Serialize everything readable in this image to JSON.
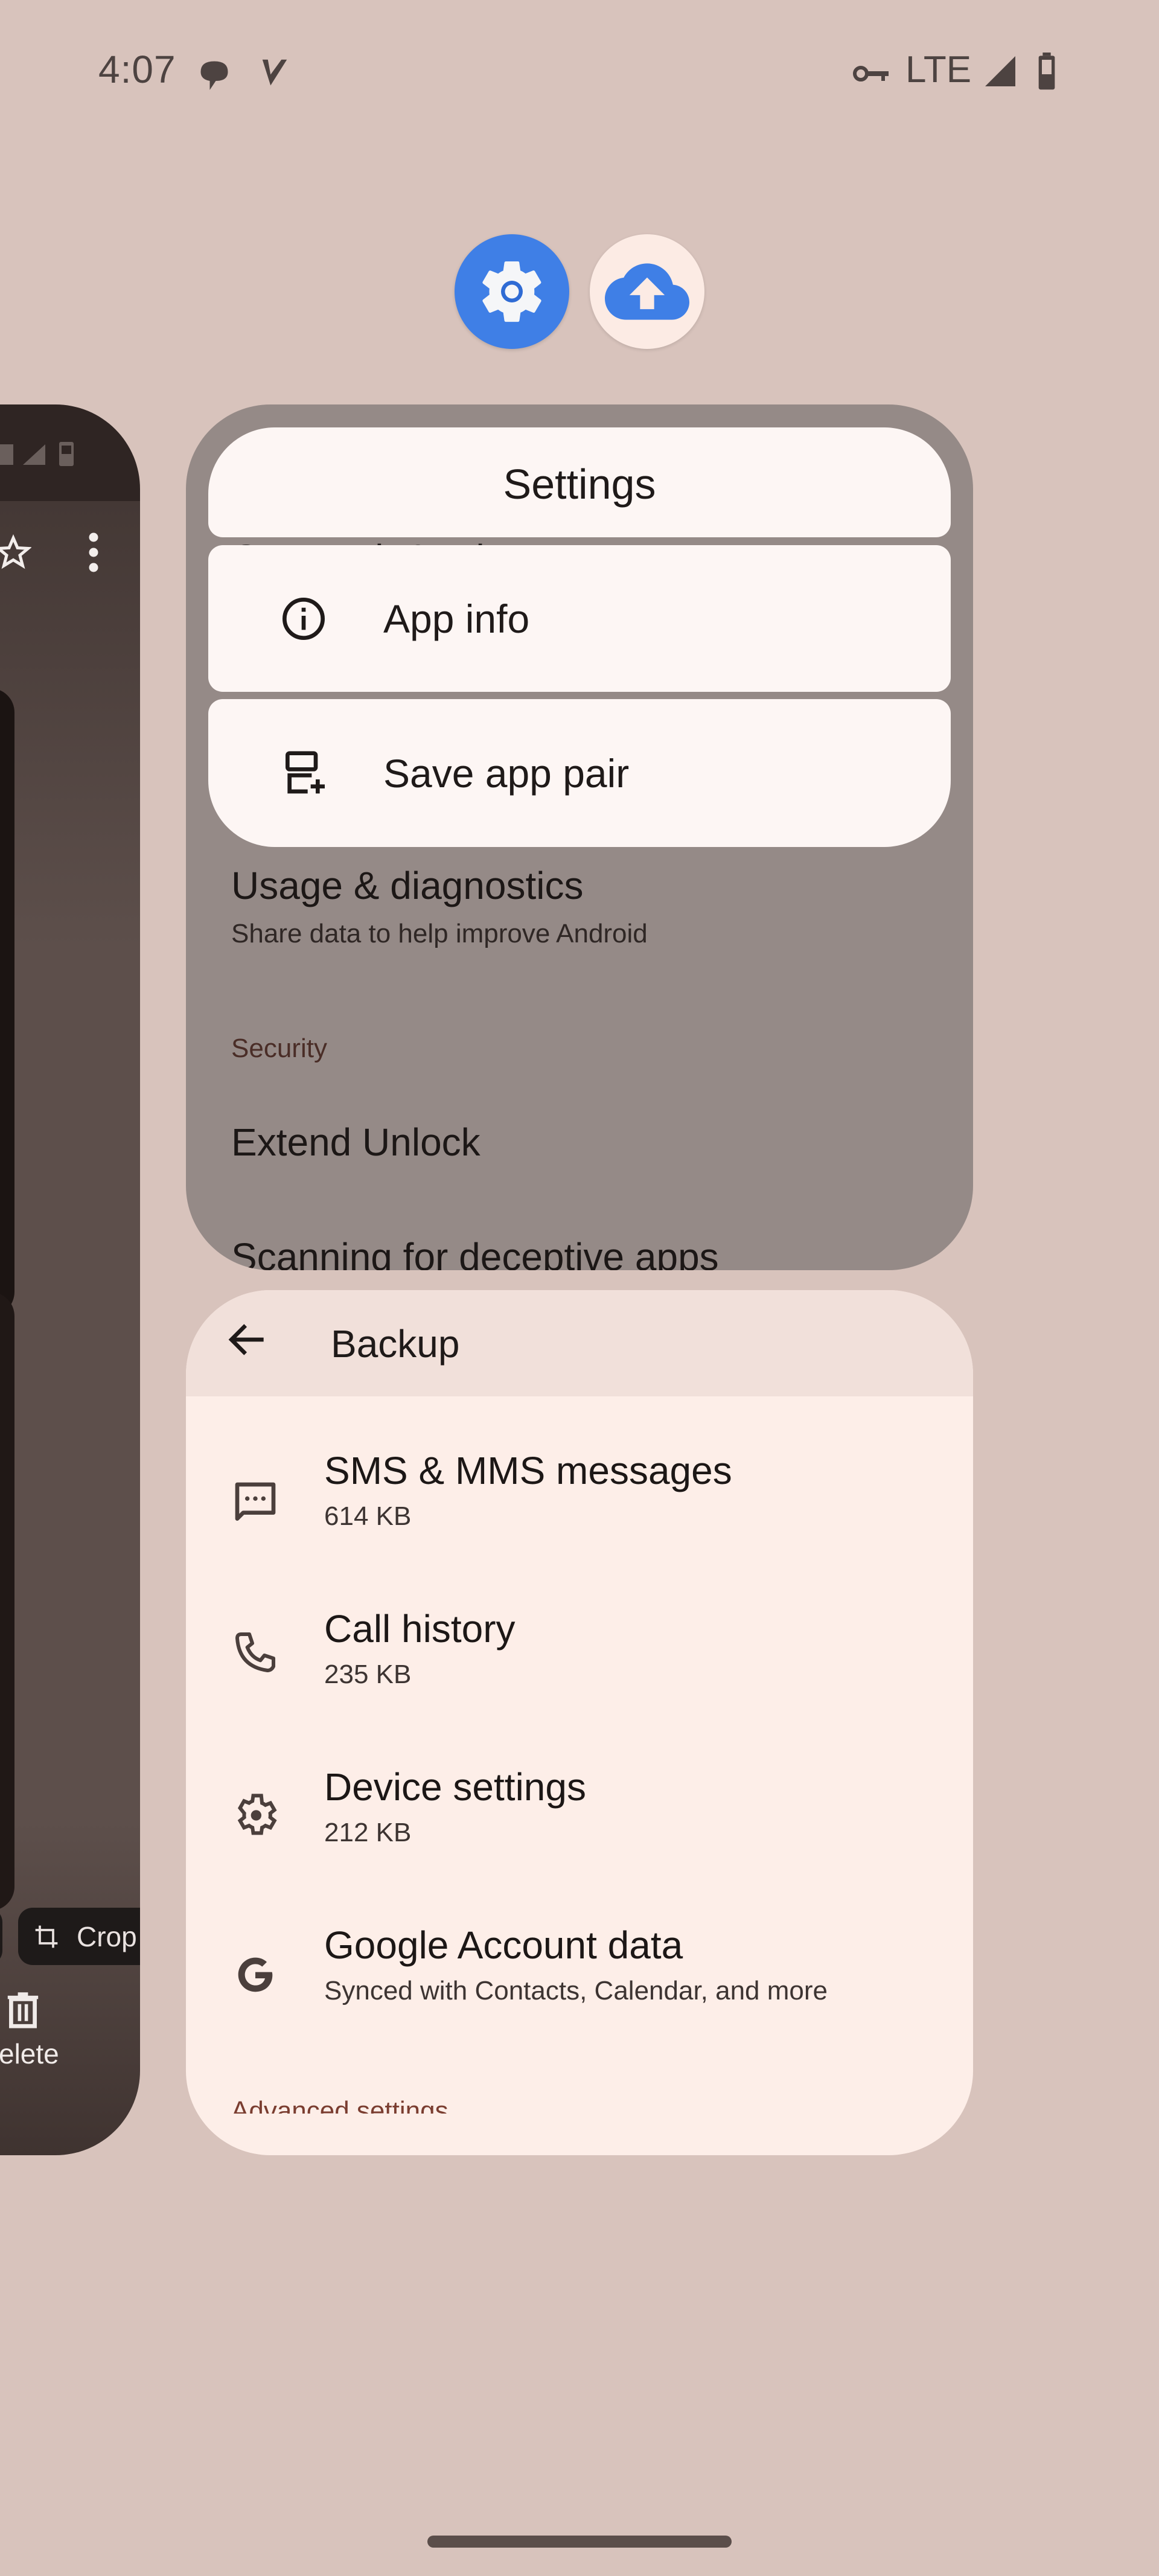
{
  "status_bar": {
    "time": "4:07",
    "network": "LTE",
    "icons": [
      "message-icon",
      "v-app-icon",
      "vpn-key-icon",
      "signal-icon",
      "battery-icon"
    ]
  },
  "app_icons": [
    {
      "name": "Settings",
      "icon": "gear-icon",
      "color": "#3f7fe6"
    },
    {
      "name": "Backup",
      "icon": "cloud-upload-icon",
      "color": "#3f7fe6"
    }
  ],
  "left_card": {
    "crop_label": "Crop",
    "delete_label": "elete"
  },
  "settings_card": {
    "menu": {
      "title": "Settings",
      "items": [
        {
          "label": "App info",
          "icon": "info-icon"
        },
        {
          "label": "Save app pair",
          "icon": "app-pair-icon"
        }
      ]
    },
    "behind_text": "Cus    Ma           it   & pri",
    "rows": [
      {
        "title": "Usage & diagnostics",
        "subtitle": "Share data to help improve Android"
      }
    ],
    "section_header": "Security",
    "security_rows": [
      "Extend Unlock",
      "Scanning for deceptive apps"
    ],
    "background": "#958a87"
  },
  "backup_card": {
    "title": "Backup",
    "items": [
      {
        "title": "SMS & MMS messages",
        "subtitle": "614 KB",
        "icon": "message-icon"
      },
      {
        "title": "Call history",
        "subtitle": "235 KB",
        "icon": "phone-icon"
      },
      {
        "title": "Device settings",
        "subtitle": "212 KB",
        "icon": "gear-icon"
      },
      {
        "title": "Google Account data",
        "subtitle": "Synced with Contacts, Calendar, and more",
        "icon": "google-icon"
      }
    ],
    "section_header": "Advanced settings"
  },
  "colors": {
    "wallpaper": "#d8c3bc",
    "accent_blue": "#3f7fe6",
    "menu_surface": "#fdf6f4",
    "backup_surface": "#fdeee8",
    "backup_header": "#f1e0da"
  }
}
